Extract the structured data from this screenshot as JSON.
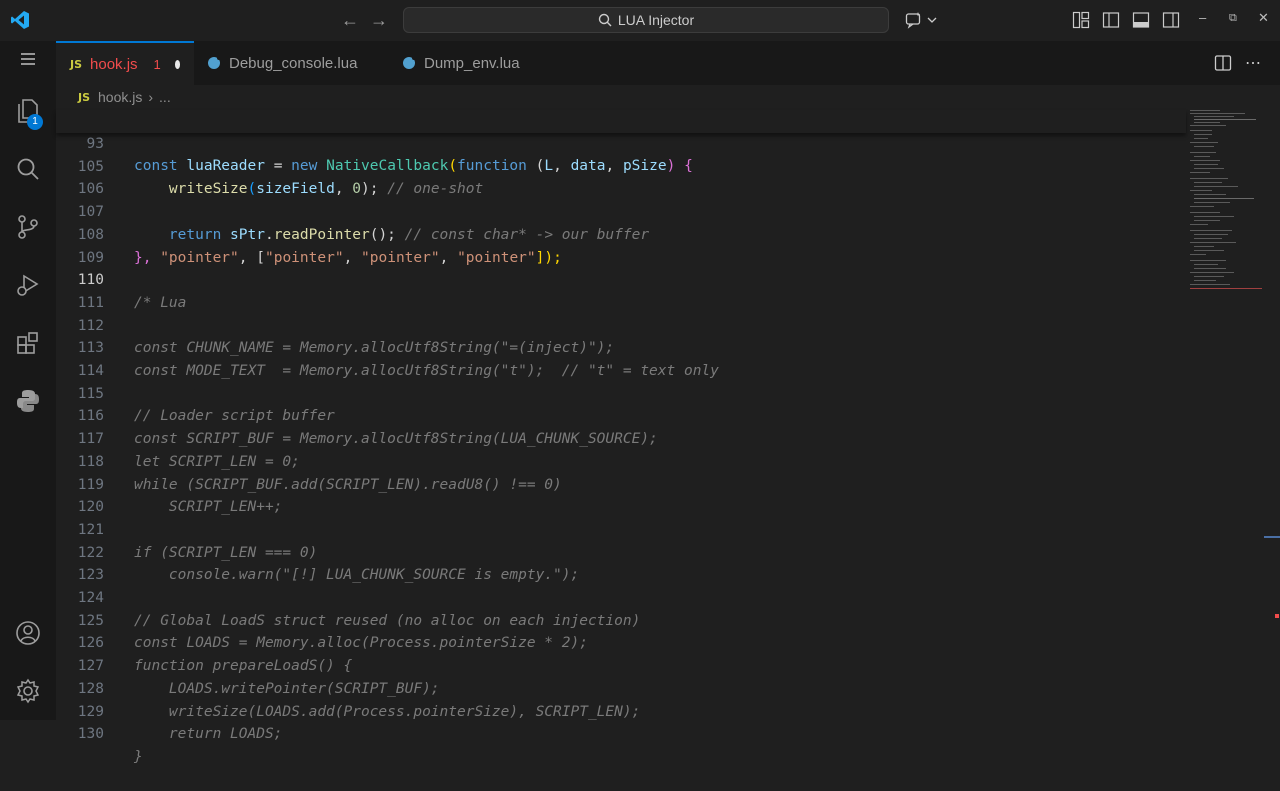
{
  "titlebar": {
    "search_label": "LUA Injector",
    "icons": [
      "vscode-logo-icon",
      "back-arrow-icon",
      "forward-arrow-icon",
      "search-icon",
      "copilot-chat-icon",
      "customize-layout-icon",
      "toggle-primary-sidebar-icon",
      "toggle-panel-icon",
      "toggle-secondary-sidebar-icon",
      "minimize-icon",
      "restore-icon",
      "close-icon"
    ]
  },
  "activitybar": {
    "items": [
      "menu-icon",
      "explorer-icon",
      "search-icon",
      "source-control-icon",
      "run-debug-icon",
      "extensions-icon",
      "python-icon",
      "account-icon",
      "settings-gear-icon"
    ],
    "explorer_badge": "1"
  },
  "tabs": [
    {
      "label": "hook.js",
      "count": "1",
      "dirty": true,
      "active": true
    },
    {
      "label": "Debug_console.lua"
    },
    {
      "label": "Dump_env.lua"
    }
  ],
  "breadcrumb": {
    "file": "hook.js",
    "ellipsis": "..."
  },
  "editor": {
    "current_line": "110",
    "lines": [
      {
        "n": "93",
        "sticky": true
      },
      {
        "n": "105"
      },
      {
        "n": "106"
      },
      {
        "n": "107"
      },
      {
        "n": "108"
      },
      {
        "n": "109"
      },
      {
        "n": "110"
      },
      {
        "n": "111"
      },
      {
        "n": "112"
      },
      {
        "n": "113"
      },
      {
        "n": "114"
      },
      {
        "n": "115"
      },
      {
        "n": "116"
      },
      {
        "n": "117"
      },
      {
        "n": "118"
      },
      {
        "n": "119"
      },
      {
        "n": "120"
      },
      {
        "n": "121"
      },
      {
        "n": "122"
      },
      {
        "n": "123"
      },
      {
        "n": "124"
      },
      {
        "n": "125"
      },
      {
        "n": "126"
      },
      {
        "n": "127"
      },
      {
        "n": "128"
      },
      {
        "n": "129"
      },
      {
        "n": "130"
      }
    ],
    "code": {
      "l93": [
        "const ",
        "luaReader",
        " = ",
        "new ",
        "NativeCallback",
        "(",
        "function",
        " (",
        "L",
        ", ",
        "data",
        ", ",
        "pSize",
        ") {"
      ],
      "l105": [
        "    ",
        "writeSize",
        "(",
        "sizeField",
        ", ",
        "0",
        "); ",
        "// one-shot"
      ],
      "l107": [
        "    ",
        "return ",
        "sPtr",
        ".",
        "readPointer",
        "(); ",
        "// const char* -> our buffer"
      ],
      "l108": [
        "}, ",
        "\"pointer\"",
        ", [",
        "\"pointer\"",
        ", ",
        "\"pointer\"",
        ", ",
        "\"pointer\"",
        "]);"
      ],
      "l110": "/* Lua",
      "l112": "const CHUNK_NAME = Memory.allocUtf8String(\"=(inject)\");",
      "l113": "const MODE_TEXT  = Memory.allocUtf8String(\"t\");  // \"t\" = text only",
      "l115": "// Loader script buffer",
      "l116": "const SCRIPT_BUF = Memory.allocUtf8String(LUA_CHUNK_SOURCE);",
      "l117": "let SCRIPT_LEN = 0;",
      "l118": "while (SCRIPT_BUF.add(SCRIPT_LEN).readU8() !== 0)",
      "l119": "    SCRIPT_LEN++;",
      "l121": "if (SCRIPT_LEN === 0)",
      "l122": "    console.warn(\"[!] LUA_CHUNK_SOURCE is empty.\");",
      "l124": "// Global LoadS struct reused (no alloc on each injection)",
      "l125": "const LOADS = Memory.alloc(Process.pointerSize * 2);",
      "l126": "function prepareLoadS() {",
      "l127": "    LOADS.writePointer(SCRIPT_BUF);",
      "l128": "    writeSize(LOADS.add(Process.pointerSize), SCRIPT_LEN);",
      "l129": "    return LOADS;",
      "l130": "}"
    }
  }
}
